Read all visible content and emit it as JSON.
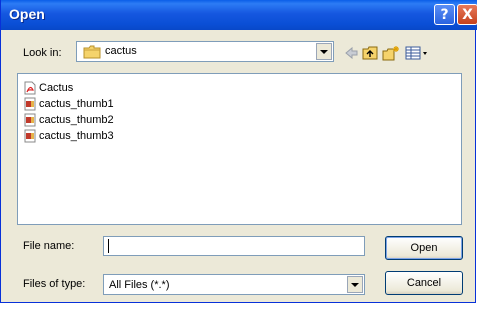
{
  "window": {
    "title": "Open"
  },
  "title_buttons": {
    "help": "?",
    "close": "X"
  },
  "look_in": {
    "label": "Look in:",
    "value": "cactus",
    "icon": "folder-icon"
  },
  "toolbar": {
    "icons": [
      "back-arrow-icon",
      "up-one-level-icon",
      "create-new-folder-icon",
      "view-menu-icon"
    ]
  },
  "files": [
    {
      "name": "Cactus",
      "icon": "pdf-file-icon"
    },
    {
      "name": "cactus_thumb1",
      "icon": "image-file-icon"
    },
    {
      "name": "cactus_thumb2",
      "icon": "image-file-icon"
    },
    {
      "name": "cactus_thumb3",
      "icon": "image-file-icon"
    }
  ],
  "file_name": {
    "label": "File name:",
    "value": ""
  },
  "files_of_type": {
    "label": "Files of type:",
    "value": "All Files (*.*)"
  },
  "buttons": {
    "open": "Open",
    "cancel": "Cancel"
  },
  "colors": {
    "titlebar": "#0a4fd6",
    "dialog_bg": "#ece9d8",
    "border": "#7f9db9"
  }
}
